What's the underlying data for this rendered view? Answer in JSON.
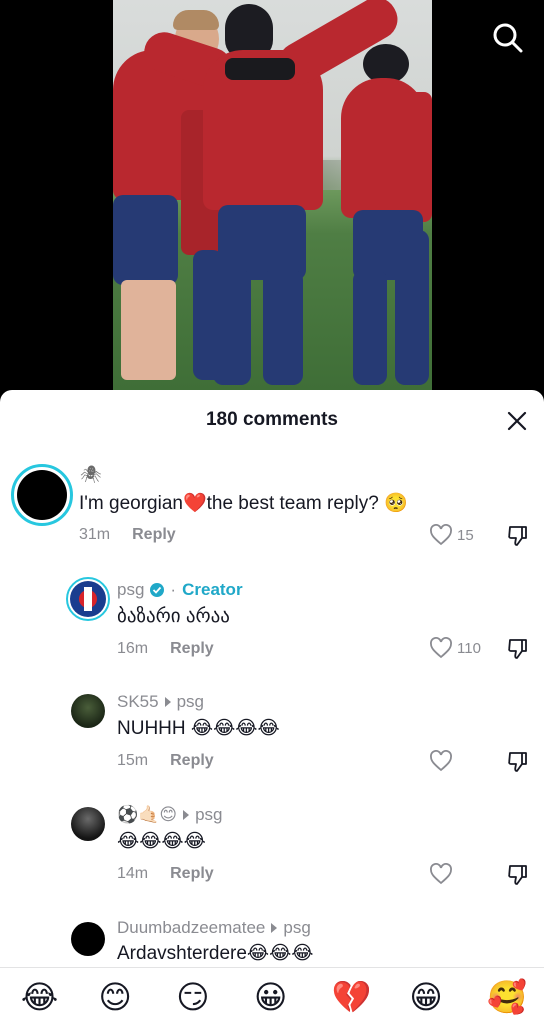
{
  "header": {
    "comments_count": "180 comments"
  },
  "comments": [
    {
      "username_symbol": "🕷",
      "text": "I'm georgian❤️the best team reply? 🥺",
      "time": "31m",
      "reply_label": "Reply",
      "likes": "15"
    },
    {
      "username": "psg",
      "creator_label": "Creator",
      "text": "ბაზარი არაა",
      "time": "16m",
      "reply_label": "Reply",
      "likes": "110"
    },
    {
      "username": "SK55",
      "reply_to": "psg",
      "text": "NUHHH 😂😂😂😂",
      "time": "15m",
      "reply_label": "Reply",
      "likes": ""
    },
    {
      "username": "⚽🤙🏻😊",
      "reply_to": "psg",
      "text": "😂😂😂😂",
      "time": "14m",
      "reply_label": "Reply",
      "likes": ""
    },
    {
      "username": "Duumbadzeematee",
      "reply_to": "psg",
      "text": "Ardavshterdere😂😂😂"
    }
  ],
  "emoji_bar": [
    "😂",
    "😊",
    "😏",
    "😀",
    "💔",
    "😁",
    "🥰"
  ],
  "colors": {
    "accent": "#20a8c8",
    "jacket": "#b9282f",
    "pants": "#263a74"
  },
  "icons": [
    "search-icon",
    "close-icon",
    "heart-icon",
    "thumbs-down-icon",
    "verified-icon",
    "reply-arrow-icon"
  ]
}
